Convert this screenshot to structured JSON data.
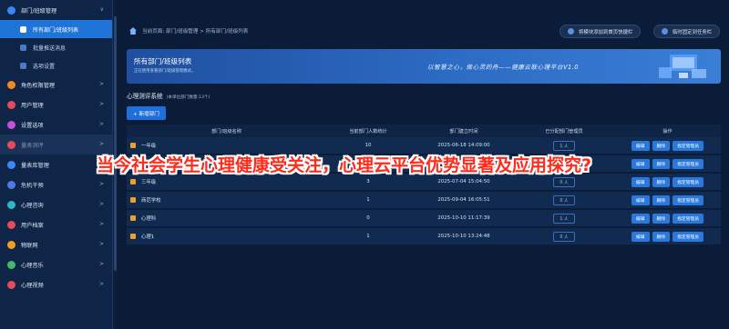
{
  "sidebar": {
    "items": [
      {
        "type": "group",
        "label": "部门/班级管理",
        "icon": "grid-icon",
        "color": "#3d86f5",
        "arrow": "∨"
      },
      {
        "type": "sub",
        "label": "所有部门/班级列表",
        "active": true
      },
      {
        "type": "sub",
        "label": "批量推送消息"
      },
      {
        "type": "sub",
        "label": "选项设置"
      },
      {
        "type": "group",
        "label": "角色权限管理",
        "icon": "role-icon",
        "color": "#f08a24",
        "arrow": ">"
      },
      {
        "type": "group",
        "label": "用户管理",
        "icon": "user-icon",
        "color": "#e64a5b",
        "arrow": ">"
      },
      {
        "type": "group",
        "label": "设置选项",
        "icon": "gear-icon",
        "color": "#c94fd8",
        "arrow": ">"
      },
      {
        "type": "group",
        "label": "量表测评",
        "icon": "test-icon",
        "color": "#e64a5b",
        "arrow": ">",
        "muted": true
      },
      {
        "type": "group",
        "label": "量表库管理",
        "icon": "library-icon",
        "color": "#3d86f5",
        "arrow": ">"
      },
      {
        "type": "group",
        "label": "危机干预",
        "icon": "crisis-icon",
        "color": "#4a7be8",
        "arrow": ">"
      },
      {
        "type": "group",
        "label": "心理咨询",
        "icon": "consult-icon",
        "color": "#2fb7c9",
        "arrow": ">"
      },
      {
        "type": "group",
        "label": "用户档案",
        "icon": "archive-icon",
        "color": "#e64a5b",
        "arrow": ">"
      },
      {
        "type": "group",
        "label": "物联网",
        "icon": "iot-icon",
        "color": "#f0a020",
        "arrow": ">"
      },
      {
        "type": "group",
        "label": "心理音乐",
        "icon": "music-icon",
        "color": "#43b86a",
        "arrow": ">"
      },
      {
        "type": "group",
        "label": "心理视频",
        "icon": "video-icon",
        "color": "#e64a5b",
        "arrow": ">"
      }
    ]
  },
  "topbar": {
    "breadcrumb": "当前页面: 部门/班级管理 > 所有部门/班级列表",
    "quick_add": "将模块添加到首页快捷栏",
    "pin": "临时固定到任务栏"
  },
  "banner": {
    "title": "所有部门/班级列表",
    "subtitle": "正在使用查看部门/班级管理模式。",
    "slogan": "以智慧之心，做心灵的舟——健康云联心理平台V1.0"
  },
  "section": {
    "title": "心理测评系统",
    "count": "(本单位部门数量:13个)",
    "add_button": "+ 新增部门"
  },
  "table": {
    "headers": [
      "部门/班级名称",
      "当前部门人数统计",
      "部门建立时间",
      "已分配部门管理员",
      "操作"
    ],
    "rows": [
      {
        "name": "一年级",
        "count": "10",
        "time": "2025-06-18 14:09:00",
        "admins": "1 人"
      },
      {
        "name": "二年级",
        "count": "0",
        "time": "2025-06-18 14:09:31",
        "admins": "0 人"
      },
      {
        "name": "三年级",
        "count": "3",
        "time": "2025-07-04 15:04:50",
        "admins": "0 人"
      },
      {
        "name": "商范学校",
        "count": "1",
        "time": "2025-09-04 16:05:51",
        "admins": "0 人"
      },
      {
        "name": "心理科",
        "count": "0",
        "time": "2025-10-10 11:17:39",
        "admins": "1 人"
      },
      {
        "name": "心理1",
        "count": "1",
        "time": "2025-10-10 13:24:48",
        "admins": "0 人"
      }
    ],
    "actions": {
      "edit": "编辑",
      "delete": "删除",
      "assign": "指定管理员"
    }
  },
  "overlay_text": "当今社会学生心理健康受关注，心理云平台优势显著及应用探究?"
}
